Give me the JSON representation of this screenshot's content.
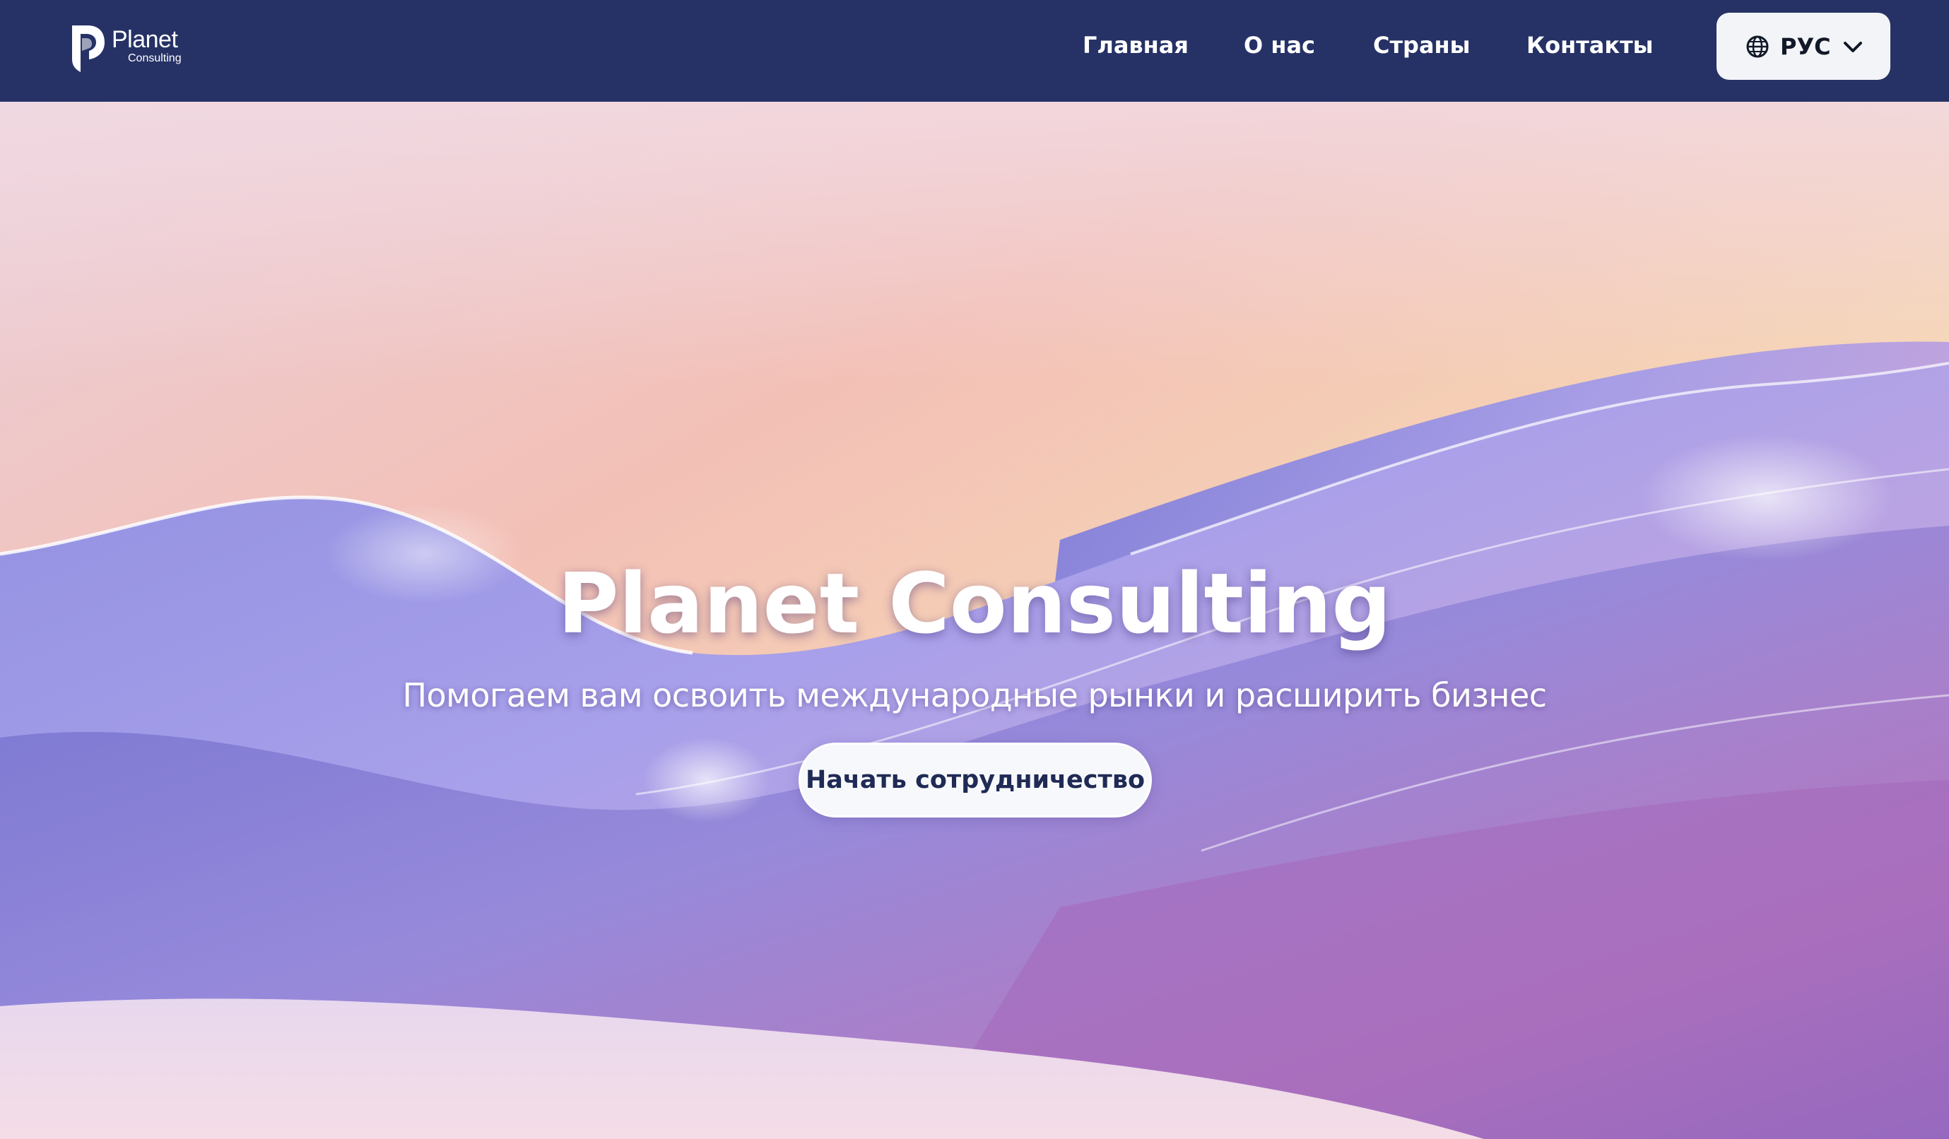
{
  "brand": {
    "name": "Planet",
    "subname": "Consulting",
    "color": "#263266"
  },
  "nav": {
    "items": [
      {
        "label": "Главная"
      },
      {
        "label": "О нас"
      },
      {
        "label": "Страны"
      },
      {
        "label": "Контакты"
      }
    ]
  },
  "language": {
    "icon": "globe-icon",
    "selected": "РУС",
    "dropdown_icon": "chevron-down-icon"
  },
  "hero": {
    "title": "Planet Consulting",
    "subtitle": "Помогаем вам освоить международные рынки и расширить бизнес",
    "cta_label": "Начать сотрудничество",
    "background": "abstract-purple-silk-waves"
  },
  "colors": {
    "header_bg": "#263266",
    "cta_text": "#1f2a55",
    "button_bg": "#f2f4f8"
  }
}
